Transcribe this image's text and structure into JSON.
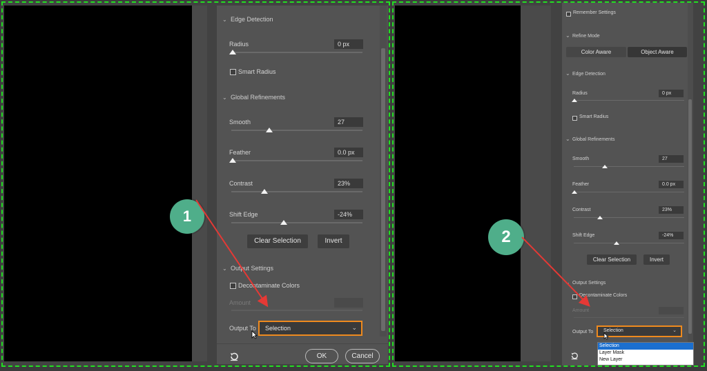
{
  "colors": {
    "frame_border": "#22e022",
    "highlight": "#ef8a1e",
    "badge": "#4fae8a",
    "arrow": "#e53935",
    "selected_option": "#1b6fcf"
  },
  "left": {
    "badge": "1",
    "edge_detection": {
      "title": "Edge Detection",
      "radius_label": "Radius",
      "radius_value": "0 px",
      "smart_radius": "Smart Radius"
    },
    "global": {
      "title": "Global Refinements",
      "smooth_label": "Smooth",
      "smooth_value": "27",
      "feather_label": "Feather",
      "feather_value": "0.0 px",
      "contrast_label": "Contrast",
      "contrast_value": "23%",
      "shift_label": "Shift Edge",
      "shift_value": "-24%"
    },
    "clear_selection": "Clear Selection",
    "invert": "Invert",
    "output": {
      "title": "Output Settings",
      "decontaminate": "Decontaminate Colors",
      "amount": "Amount",
      "output_to": "Output To",
      "output_value": "Selection"
    },
    "ok": "OK",
    "cancel": "Cancel"
  },
  "right": {
    "badge": "2",
    "remember": "Remember Settings",
    "refine_mode": {
      "title": "Refine Mode",
      "color_aware": "Color Aware",
      "object_aware": "Object Aware"
    },
    "edge_detection": {
      "title": "Edge Detection",
      "radius_label": "Radius",
      "radius_value": "0 px",
      "smart_radius": "Smart Radius"
    },
    "global": {
      "title": "Global Refinements",
      "smooth_label": "Smooth",
      "smooth_value": "27",
      "feather_label": "Feather",
      "feather_value": "0.0 px",
      "contrast_label": "Contrast",
      "contrast_value": "23%",
      "shift_label": "Shift Edge",
      "shift_value": "-24%"
    },
    "clear_selection": "Clear Selection",
    "invert": "Invert",
    "output": {
      "title": "Output Settings",
      "decontaminate": "Decontaminate Colors",
      "amount": "Amount",
      "output_to": "Output To",
      "output_value": "Selection",
      "options": [
        "Selection",
        "Layer Mask",
        "New Layer"
      ]
    }
  }
}
